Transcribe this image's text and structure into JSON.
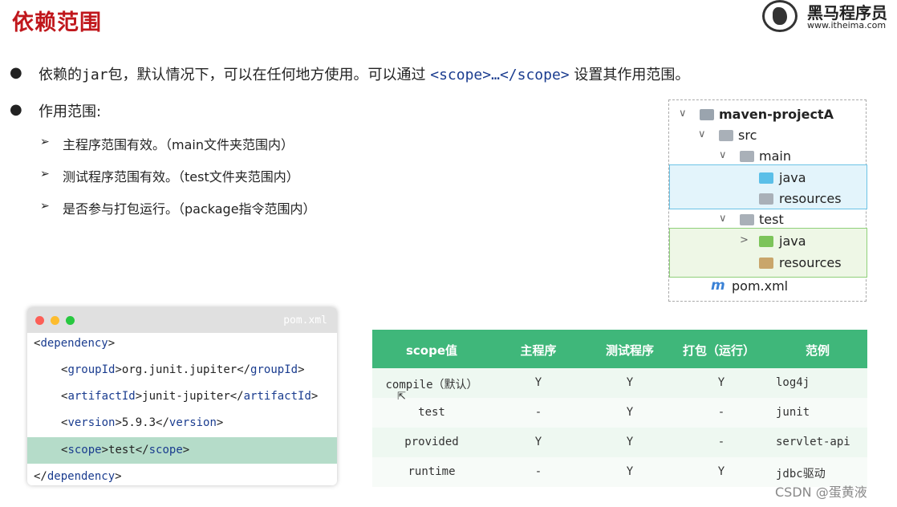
{
  "title": "依赖范围",
  "logo": {
    "name": "黑马程序员",
    "url": "www.itheima.com"
  },
  "bullets": {
    "b1_pre": "依赖的",
    "b1_jar": "jar",
    "b1_mid": "包，默认情况下，可以在任何地方使用。可以通过 ",
    "b1_code": "<scope>…</scope>",
    "b1_post": " 设置其作用范围。",
    "b2": "作用范围:"
  },
  "sub_items": [
    "主程序范围有效。（main文件夹范围内）",
    "测试程序范围有效。（test文件夹范围内）",
    "是否参与打包运行。（package指令范围内）"
  ],
  "tree": {
    "root": "maven-projectA",
    "src": "src",
    "main": "main",
    "main_java": "java",
    "main_resources": "resources",
    "test": "test",
    "test_java": "java",
    "test_resources": "resources",
    "pom": "pom.xml"
  },
  "code": {
    "filename": "pom.xml",
    "lines": [
      {
        "o": "<",
        "tag": "dependency",
        "c": ">",
        "text": "",
        "o2": "",
        "tag2": "",
        "c2": ""
      },
      {
        "o": "<",
        "tag": "groupId",
        "c": ">",
        "text": "org.junit.jupiter",
        "o2": "</",
        "tag2": "groupId",
        "c2": ">"
      },
      {
        "o": "<",
        "tag": "artifactId",
        "c": ">",
        "text": "junit-jupiter",
        "o2": "</",
        "tag2": "artifactId",
        "c2": ">"
      },
      {
        "o": "<",
        "tag": "version",
        "c": ">",
        "text": "5.9.3",
        "o2": "</",
        "tag2": "version",
        "c2": ">"
      },
      {
        "o": "<",
        "tag": "scope",
        "c": ">",
        "text": "test",
        "o2": "</",
        "tag2": "scope",
        "c2": ">"
      },
      {
        "o": "</",
        "tag": "dependency",
        "c": ">",
        "text": "",
        "o2": "",
        "tag2": "",
        "c2": ""
      }
    ]
  },
  "table": {
    "headers": [
      "scope值",
      "主程序",
      "测试程序",
      "打包（运行）",
      "范例"
    ],
    "rows": [
      [
        "compile（默认）",
        "Y",
        "Y",
        "Y",
        "log4j"
      ],
      [
        "test",
        "-",
        "Y",
        "-",
        "junit"
      ],
      [
        "provided",
        "Y",
        "Y",
        "-",
        "servlet-api"
      ],
      [
        "runtime",
        "-",
        "Y",
        "Y",
        "jdbc驱动"
      ]
    ]
  },
  "watermark": "CSDN @蛋黄液",
  "colors": {
    "title": "#c0171c",
    "table_header": "#3fb77a",
    "code_highlight": "#b5dcc9",
    "tag": "#1a3c8f"
  }
}
